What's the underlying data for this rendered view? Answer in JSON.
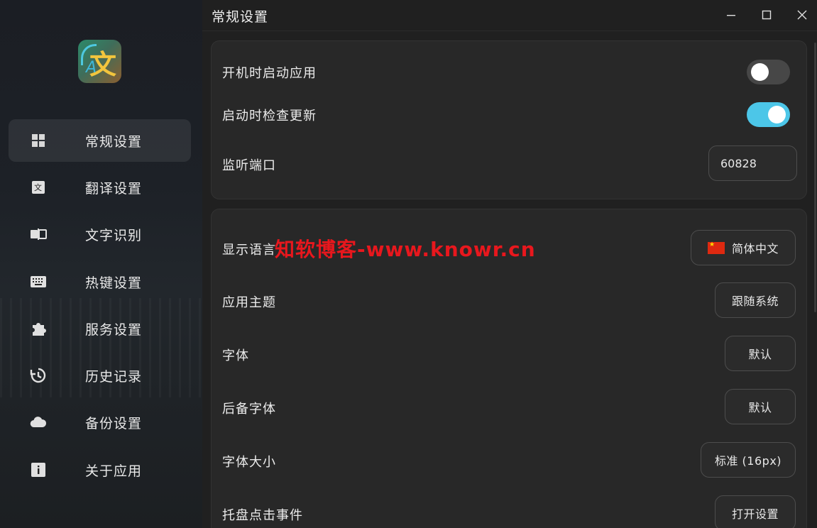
{
  "app": {
    "title": "常规设置"
  },
  "sidebar": {
    "logo_glyph": "文",
    "logo_latin": "A",
    "items": [
      {
        "label": "常规设置",
        "icon": "grid-icon",
        "active": true
      },
      {
        "label": "翻译设置",
        "icon": "translate-icon",
        "active": false
      },
      {
        "label": "文字识别",
        "icon": "ocr-icon",
        "active": false
      },
      {
        "label": "热键设置",
        "icon": "keyboard-icon",
        "active": false
      },
      {
        "label": "服务设置",
        "icon": "puzzle-icon",
        "active": false
      },
      {
        "label": "历史记录",
        "icon": "history-icon",
        "active": false
      },
      {
        "label": "备份设置",
        "icon": "cloud-icon",
        "active": false
      },
      {
        "label": "关于应用",
        "icon": "info-icon",
        "active": false
      }
    ]
  },
  "general": {
    "autostart_label": "开机时启动应用",
    "autostart_on": false,
    "check_update_label": "启动时检查更新",
    "check_update_on": true,
    "port_label": "监听端口",
    "port_value": "60828"
  },
  "appearance": {
    "language_label": "显示语言",
    "language_value": "简体中文",
    "theme_label": "应用主题",
    "theme_value": "跟随系统",
    "font_label": "字体",
    "font_value": "默认",
    "fallback_font_label": "后备字体",
    "fallback_font_value": "默认",
    "font_size_label": "字体大小",
    "font_size_value": "标准 (16px)",
    "tray_click_label": "托盘点击事件",
    "tray_click_value": "打开设置"
  },
  "watermark": "知软博客-www.knowr.cn",
  "colors": {
    "accent": "#4cc6e8",
    "watermark": "#e8171d",
    "background": "#202020",
    "card": "#282828"
  }
}
